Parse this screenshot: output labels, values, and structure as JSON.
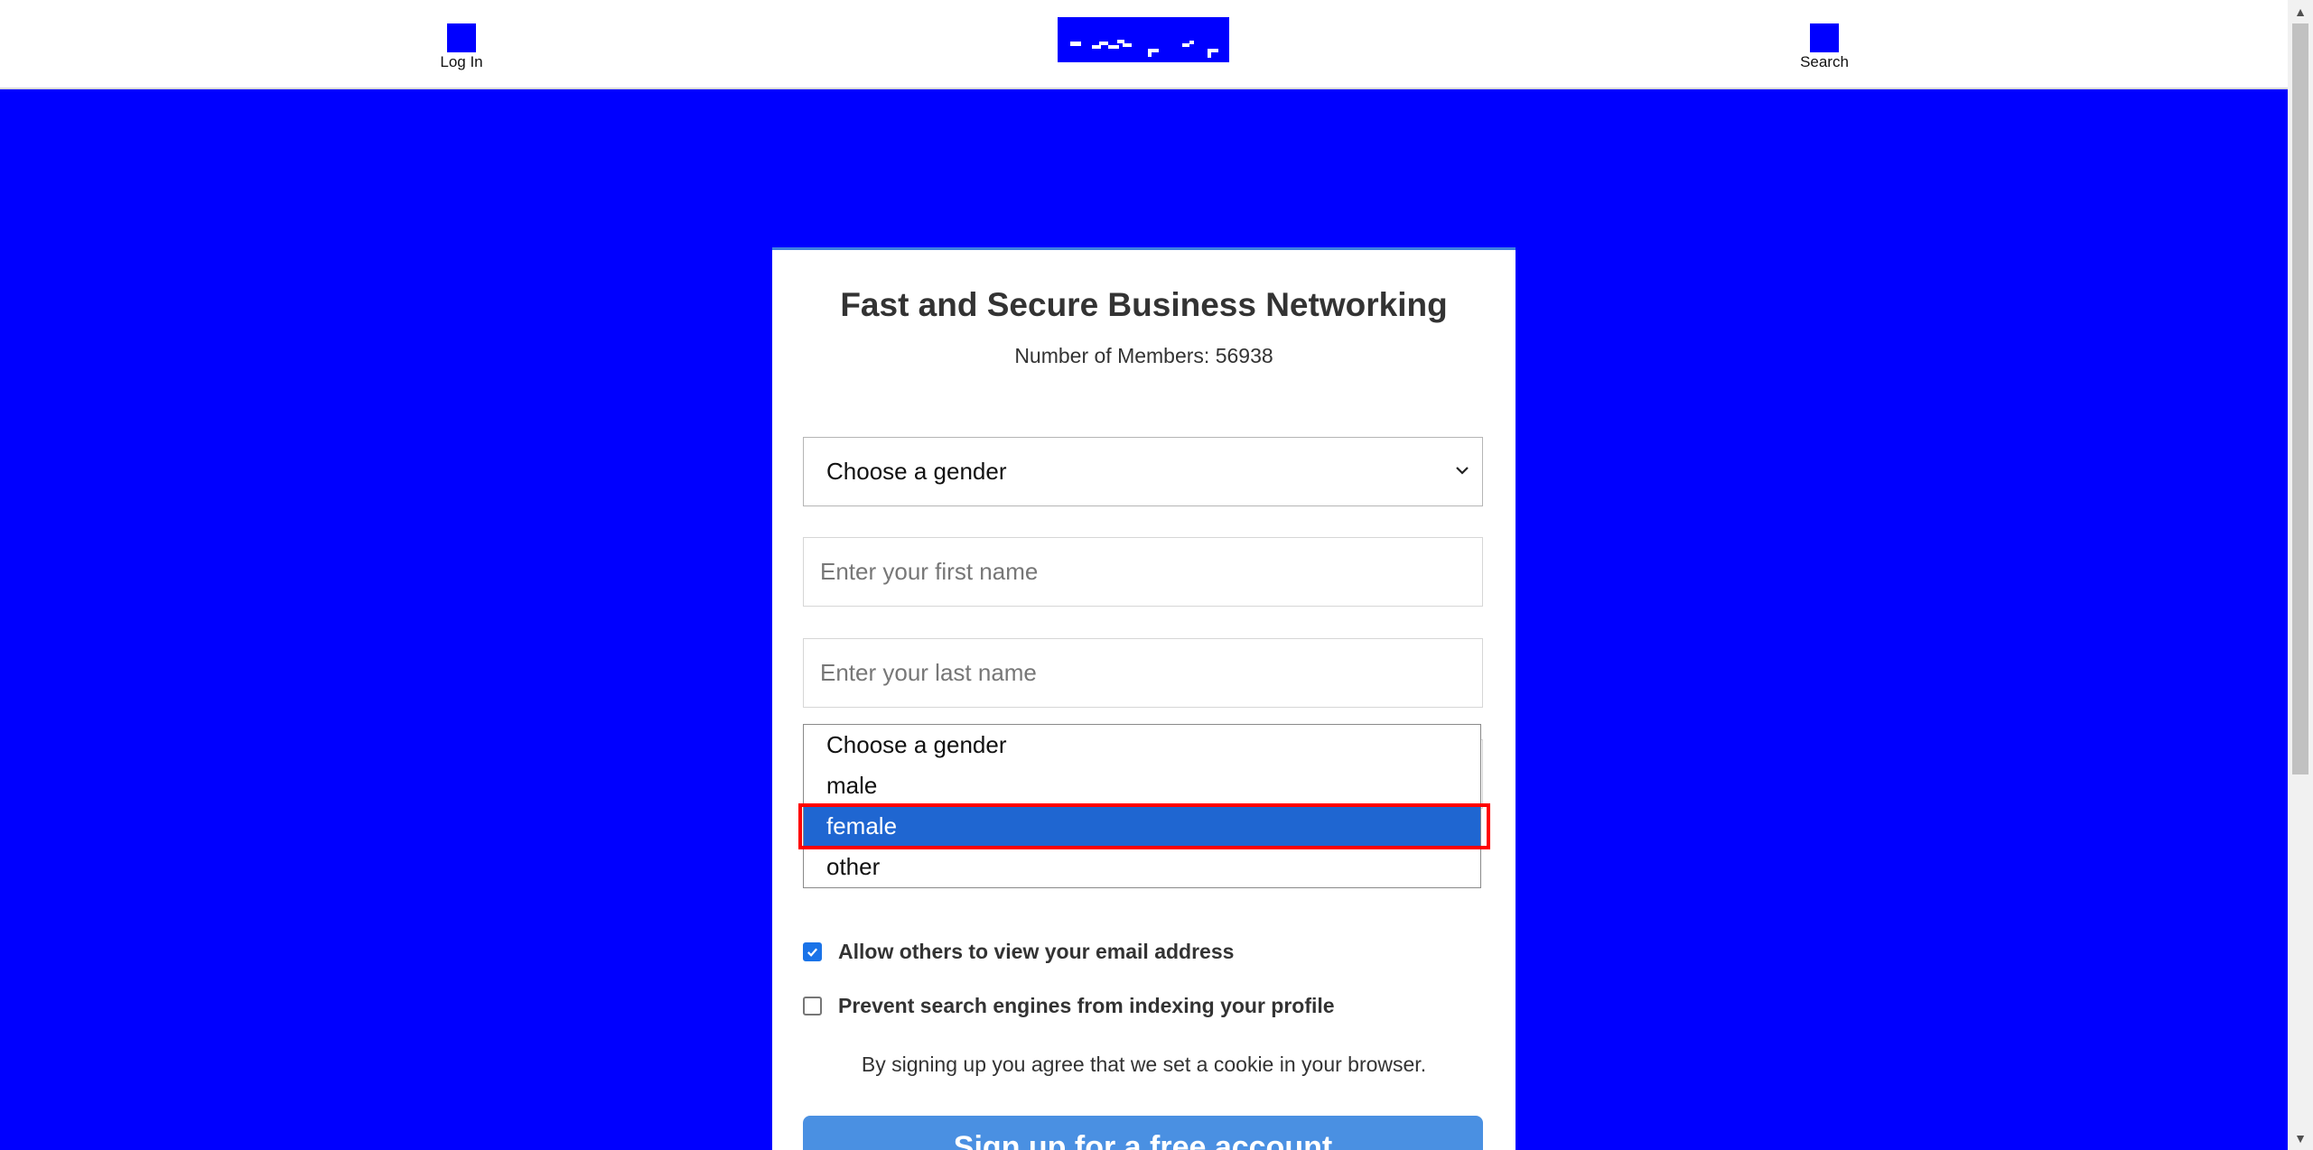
{
  "header": {
    "login_label": "Log In",
    "search_label": "Search"
  },
  "card": {
    "title": "Fast and Secure Business Networking",
    "members_label": "Number of Members:",
    "members_count": "56938"
  },
  "form": {
    "gender_selected": "Choose a gender",
    "gender_options": [
      "Choose a gender",
      "male",
      "female",
      "other"
    ],
    "highlighted_option": "female",
    "first_name_placeholder": "Enter your first name",
    "last_name_placeholder": "Enter your last name",
    "allow_email_label": "Allow others to view your email address",
    "allow_email_checked": true,
    "prevent_indexing_label": "Prevent search engines from indexing your profile",
    "prevent_indexing_checked": false,
    "cookie_note": "By signing up you agree that we set a cookie in your browser.",
    "signup_label": "Sign up for a free account"
  },
  "colors": {
    "background": "#0000ff",
    "selected_option": "#1f66d1",
    "signup_button": "#4a90e2",
    "highlight_box": "#ff0000"
  },
  "icons": {
    "login": "user-icon",
    "search": "search-icon",
    "select": "chevron-down-icon",
    "checkbox": "check-icon"
  }
}
